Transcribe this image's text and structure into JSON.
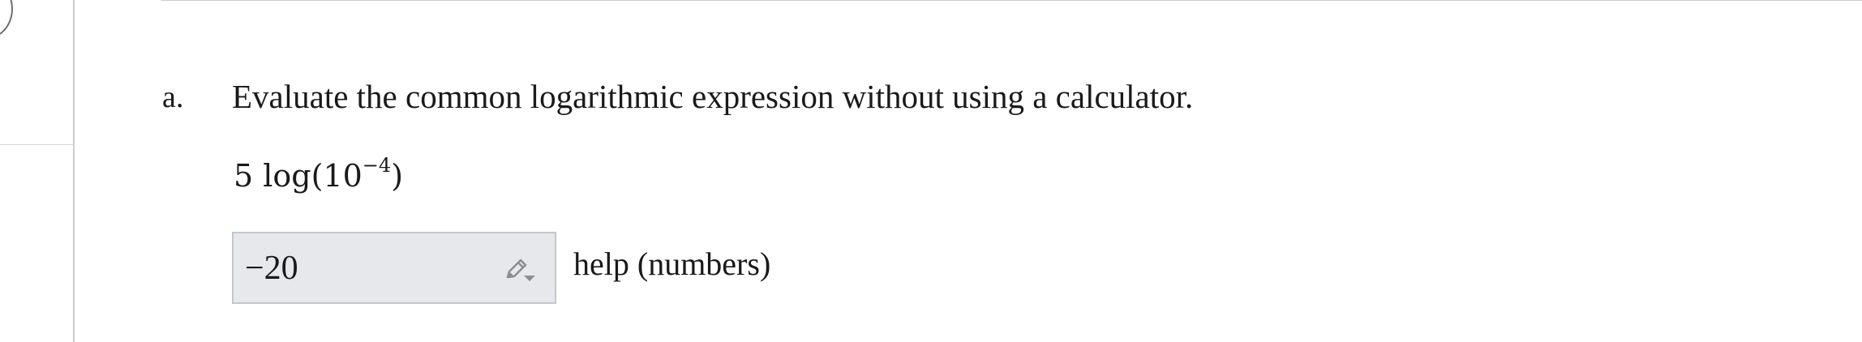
{
  "question": {
    "part_label": "a.",
    "prompt": "Evaluate the common logarithmic expression without using a calculator.",
    "expression": {
      "prefix": "5 log(10",
      "exponent": "−4",
      "suffix": ")"
    }
  },
  "answer": {
    "value": "−20",
    "tool_icon": "pencil-dropdown-icon"
  },
  "help": {
    "label": "help (numbers)"
  },
  "colors": {
    "answer_bg": "#e6e8eb",
    "border": "#c9ccd1",
    "text": "#1a1a1a"
  }
}
